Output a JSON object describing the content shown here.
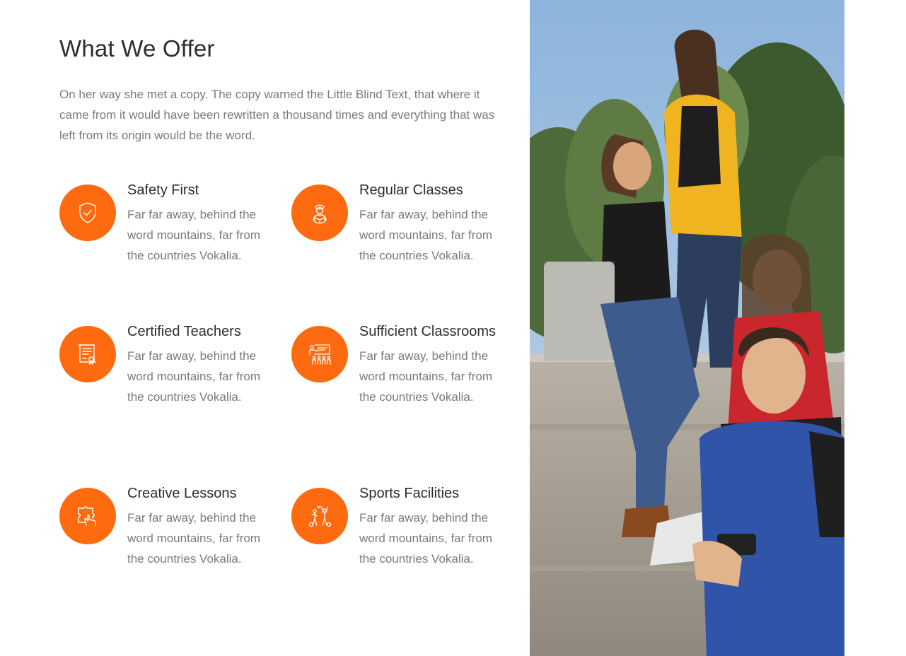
{
  "section": {
    "title": "What We Offer",
    "intro": "On her way she met a copy. The copy warned the Little Blind Text, that where it came from it would have been rewritten a thousand times and everything that was left from its origin would be the word."
  },
  "features": [
    {
      "title": "Safety First",
      "description": "Far far away, behind the word mountains, far from the countries Vokalia.",
      "icon": "shield-check-icon"
    },
    {
      "title": "Regular Classes",
      "description": "Far far away, behind the word mountains, far from the countries Vokalia.",
      "icon": "student-reading-icon"
    },
    {
      "title": "Certified Teachers",
      "description": "Far far away, behind the word mountains, far from the countries Vokalia.",
      "icon": "certificate-icon"
    },
    {
      "title": "Sufficient Classrooms",
      "description": "Far far away, behind the word mountains, far from the countries Vokalia.",
      "icon": "classroom-icon"
    },
    {
      "title": "Creative Lessons",
      "description": "Far far away, behind the word mountains, far from the countries Vokalia.",
      "icon": "puzzle-hand-icon"
    },
    {
      "title": "Sports Facilities",
      "description": "Far far away, behind the word mountains, far from the countries Vokalia.",
      "icon": "sports-icon"
    }
  ],
  "colors": {
    "accent": "#fd6a0f",
    "heading": "#2d2d2d",
    "body_text": "#7a7a7a"
  },
  "photo": {
    "subject": "students-sitting-on-steps-photo"
  }
}
